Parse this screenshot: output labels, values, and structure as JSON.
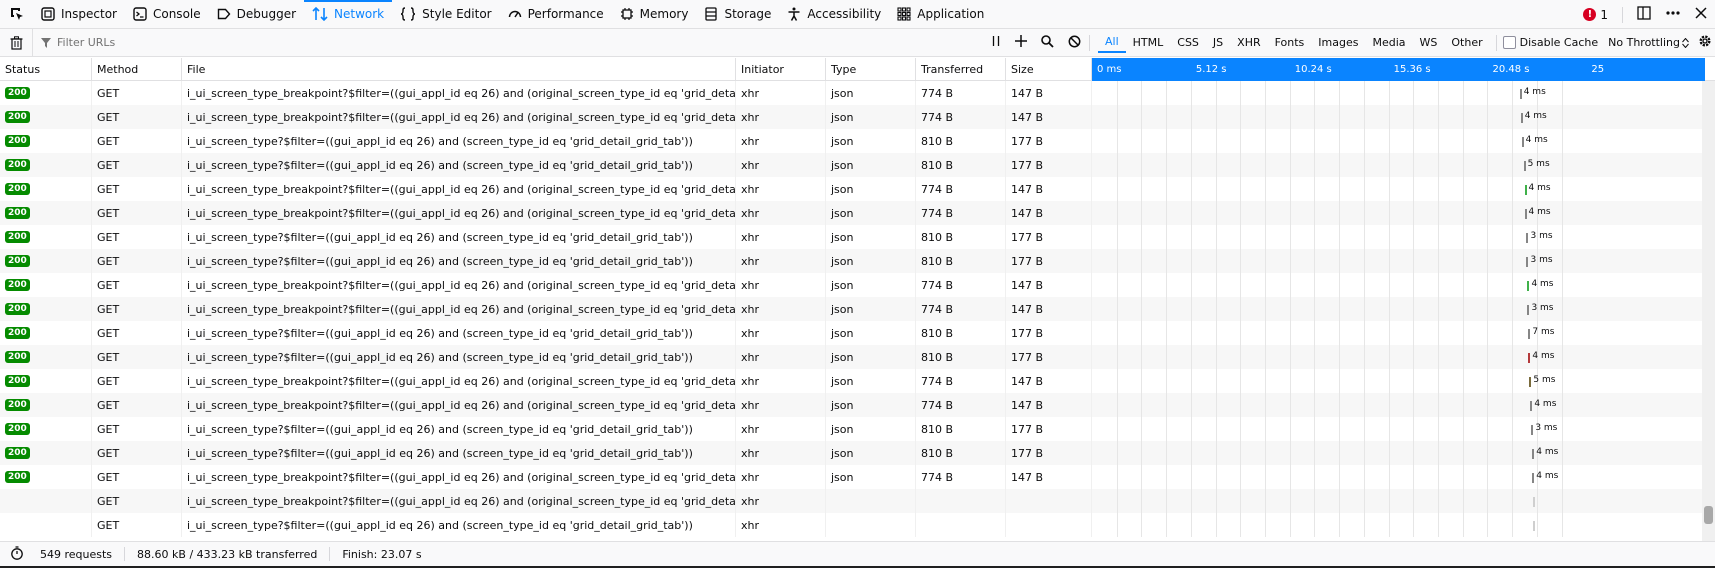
{
  "toolbar": {
    "tabs": [
      {
        "label": "Inspector",
        "icon": "inspector-icon"
      },
      {
        "label": "Console",
        "icon": "console-icon"
      },
      {
        "label": "Debugger",
        "icon": "debugger-icon"
      },
      {
        "label": "Network",
        "icon": "network-icon",
        "active": true
      },
      {
        "label": "Style Editor",
        "icon": "style-editor-icon"
      },
      {
        "label": "Performance",
        "icon": "performance-icon"
      },
      {
        "label": "Memory",
        "icon": "memory-icon"
      },
      {
        "label": "Storage",
        "icon": "storage-icon"
      },
      {
        "label": "Accessibility",
        "icon": "accessibility-icon"
      },
      {
        "label": "Application",
        "icon": "application-icon"
      }
    ],
    "error_count": "1"
  },
  "filter": {
    "placeholder": "Filter URLs",
    "types": [
      "All",
      "HTML",
      "CSS",
      "JS",
      "XHR",
      "Fonts",
      "Images",
      "Media",
      "WS",
      "Other"
    ],
    "active_type": "All",
    "disable_cache_label": "Disable Cache",
    "throttling": "No Throttling"
  },
  "columns": {
    "status": "Status",
    "method": "Method",
    "file": "File",
    "initiator": "Initiator",
    "type": "Type",
    "transferred": "Transferred",
    "size": "Size"
  },
  "waterfall": {
    "ticks": [
      "0 ms",
      "5.12 s",
      "10.24 s",
      "15.36 s",
      "20.48 s",
      "25"
    ],
    "scale_max_s": 25.6
  },
  "requests": [
    {
      "status": "200",
      "method": "GET",
      "file": "i_ui_screen_type_breakpoint?$filter=((gui_appl_id eq 26) and (original_screen_type_id eq 'grid_detail_grid_tab'))",
      "initiator": "xhr",
      "type": "json",
      "transferred": "774 B",
      "size": "147 B",
      "timing": "4 ms",
      "start_s": 22.15,
      "bar_color": "#868686"
    },
    {
      "status": "200",
      "method": "GET",
      "file": "i_ui_screen_type_breakpoint?$filter=((gui_appl_id eq 26) and (original_screen_type_id eq 'grid_detail_grid_tab'))",
      "initiator": "xhr",
      "type": "json",
      "transferred": "774 B",
      "size": "147 B",
      "timing": "4 ms",
      "start_s": 22.2,
      "bar_color": "#868686"
    },
    {
      "status": "200",
      "method": "GET",
      "file": "i_ui_screen_type?$filter=((gui_appl_id eq 26) and (screen_type_id eq 'grid_detail_grid_tab'))",
      "initiator": "xhr",
      "type": "json",
      "transferred": "810 B",
      "size": "177 B",
      "timing": "4 ms",
      "start_s": 22.25,
      "bar_color": "#868686"
    },
    {
      "status": "200",
      "method": "GET",
      "file": "i_ui_screen_type?$filter=((gui_appl_id eq 26) and (screen_type_id eq 'grid_detail_grid_tab'))",
      "initiator": "xhr",
      "type": "json",
      "transferred": "810 B",
      "size": "177 B",
      "timing": "5 ms",
      "start_s": 22.35,
      "bar_color": "#868686"
    },
    {
      "status": "200",
      "method": "GET",
      "file": "i_ui_screen_type_breakpoint?$filter=((gui_appl_id eq 26) and (original_screen_type_id eq 'grid_detail_grid_tab'))",
      "initiator": "xhr",
      "type": "json",
      "transferred": "774 B",
      "size": "147 B",
      "timing": "4 ms",
      "start_s": 22.4,
      "bar_color": "#3fb14a"
    },
    {
      "status": "200",
      "method": "GET",
      "file": "i_ui_screen_type_breakpoint?$filter=((gui_appl_id eq 26) and (original_screen_type_id eq 'grid_detail_grid_tab'))",
      "initiator": "xhr",
      "type": "json",
      "transferred": "774 B",
      "size": "147 B",
      "timing": "4 ms",
      "start_s": 22.4,
      "bar_color": "#868686"
    },
    {
      "status": "200",
      "method": "GET",
      "file": "i_ui_screen_type?$filter=((gui_appl_id eq 26) and (screen_type_id eq 'grid_detail_grid_tab'))",
      "initiator": "xhr",
      "type": "json",
      "transferred": "810 B",
      "size": "177 B",
      "timing": "3 ms",
      "start_s": 22.5,
      "bar_color": "#868686"
    },
    {
      "status": "200",
      "method": "GET",
      "file": "i_ui_screen_type?$filter=((gui_appl_id eq 26) and (screen_type_id eq 'grid_detail_grid_tab'))",
      "initiator": "xhr",
      "type": "json",
      "transferred": "810 B",
      "size": "177 B",
      "timing": "3 ms",
      "start_s": 22.5,
      "bar_color": "#868686"
    },
    {
      "status": "200",
      "method": "GET",
      "file": "i_ui_screen_type_breakpoint?$filter=((gui_appl_id eq 26) and (original_screen_type_id eq 'grid_detail_grid_tab'))",
      "initiator": "xhr",
      "type": "json",
      "transferred": "774 B",
      "size": "147 B",
      "timing": "4 ms",
      "start_s": 22.55,
      "bar_color": "#3fb14a"
    },
    {
      "status": "200",
      "method": "GET",
      "file": "i_ui_screen_type_breakpoint?$filter=((gui_appl_id eq 26) and (original_screen_type_id eq 'grid_detail_grid_tab'))",
      "initiator": "xhr",
      "type": "json",
      "transferred": "774 B",
      "size": "147 B",
      "timing": "3 ms",
      "start_s": 22.55,
      "bar_color": "#868686"
    },
    {
      "status": "200",
      "method": "GET",
      "file": "i_ui_screen_type?$filter=((gui_appl_id eq 26) and (screen_type_id eq 'grid_detail_grid_tab'))",
      "initiator": "xhr",
      "type": "json",
      "transferred": "810 B",
      "size": "177 B",
      "timing": "7 ms",
      "start_s": 22.6,
      "bar_color": "#868686"
    },
    {
      "status": "200",
      "method": "GET",
      "file": "i_ui_screen_type?$filter=((gui_appl_id eq 26) and (screen_type_id eq 'grid_detail_grid_tab'))",
      "initiator": "xhr",
      "type": "json",
      "transferred": "810 B",
      "size": "177 B",
      "timing": "4 ms",
      "start_s": 22.6,
      "bar_color": "#b4393b"
    },
    {
      "status": "200",
      "method": "GET",
      "file": "i_ui_screen_type_breakpoint?$filter=((gui_appl_id eq 26) and (original_screen_type_id eq 'grid_detail_grid_tab'))",
      "initiator": "xhr",
      "type": "json",
      "transferred": "774 B",
      "size": "147 B",
      "timing": "5 ms",
      "start_s": 22.65,
      "bar_color": "#7a6b3c"
    },
    {
      "status": "200",
      "method": "GET",
      "file": "i_ui_screen_type_breakpoint?$filter=((gui_appl_id eq 26) and (original_screen_type_id eq 'grid_detail_grid_tab'))",
      "initiator": "xhr",
      "type": "json",
      "transferred": "774 B",
      "size": "147 B",
      "timing": "4 ms",
      "start_s": 22.7,
      "bar_color": "#868686"
    },
    {
      "status": "200",
      "method": "GET",
      "file": "i_ui_screen_type?$filter=((gui_appl_id eq 26) and (screen_type_id eq 'grid_detail_grid_tab'))",
      "initiator": "xhr",
      "type": "json",
      "transferred": "810 B",
      "size": "177 B",
      "timing": "3 ms",
      "start_s": 22.75,
      "bar_color": "#868686"
    },
    {
      "status": "200",
      "method": "GET",
      "file": "i_ui_screen_type?$filter=((gui_appl_id eq 26) and (screen_type_id eq 'grid_detail_grid_tab'))",
      "initiator": "xhr",
      "type": "json",
      "transferred": "810 B",
      "size": "177 B",
      "timing": "4 ms",
      "start_s": 22.8,
      "bar_color": "#868686"
    },
    {
      "status": "200",
      "method": "GET",
      "file": "i_ui_screen_type_breakpoint?$filter=((gui_appl_id eq 26) and (original_screen_type_id eq 'grid_detail_grid_tab'))",
      "initiator": "xhr",
      "type": "json",
      "transferred": "774 B",
      "size": "147 B",
      "timing": "4 ms",
      "start_s": 22.8,
      "bar_color": "#868686"
    },
    {
      "status": "",
      "method": "GET",
      "file": "i_ui_screen_type_breakpoint?$filter=((gui_appl_id eq 26) and (original_screen_type_id eq 'grid_detail_grid_tab'))",
      "initiator": "xhr",
      "type": "",
      "transferred": "",
      "size": "",
      "timing": "",
      "start_s": 22.85,
      "bar_color": "#cfcfcf"
    },
    {
      "status": "",
      "method": "GET",
      "file": "i_ui_screen_type?$filter=((gui_appl_id eq 26) and (screen_type_id eq 'grid_detail_grid_tab'))",
      "initiator": "xhr",
      "type": "",
      "transferred": "",
      "size": "",
      "timing": "",
      "start_s": 22.85,
      "bar_color": "#cfcfcf"
    }
  ],
  "statusbar": {
    "requests": "549 requests",
    "transferred": "88.60 kB / 433.23 kB transferred",
    "finish": "Finish: 23.07 s"
  }
}
